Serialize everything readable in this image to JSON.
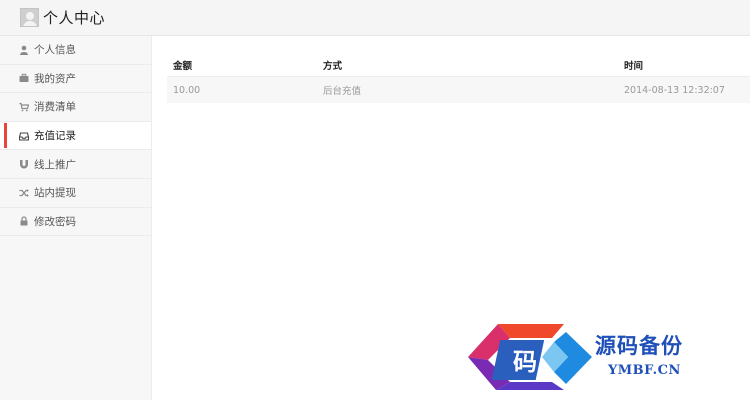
{
  "header": {
    "title": "个人中心",
    "avatar_icon": "user-avatar-icon"
  },
  "sidebar": {
    "items": [
      {
        "label": "个人信息",
        "icon": "user-icon",
        "active": false
      },
      {
        "label": "我的资产",
        "icon": "briefcase-icon",
        "active": false
      },
      {
        "label": "消费清单",
        "icon": "cart-icon",
        "active": false
      },
      {
        "label": "充值记录",
        "icon": "inbox-icon",
        "active": true
      },
      {
        "label": "线上推广",
        "icon": "magnet-icon",
        "active": false
      },
      {
        "label": "站内提现",
        "icon": "shuffle-icon",
        "active": false
      },
      {
        "label": "修改密码",
        "icon": "lock-icon",
        "active": false
      }
    ],
    "accent_color": "#e8453c"
  },
  "table": {
    "headers": [
      "金额",
      "方式",
      "时间"
    ],
    "rows": [
      [
        "10.00",
        "后台充值",
        "2014-08-13 12:32:07"
      ]
    ]
  },
  "watermark": {
    "glyph": "码",
    "text": "源码备份",
    "subtext": "YMBF.CN"
  }
}
